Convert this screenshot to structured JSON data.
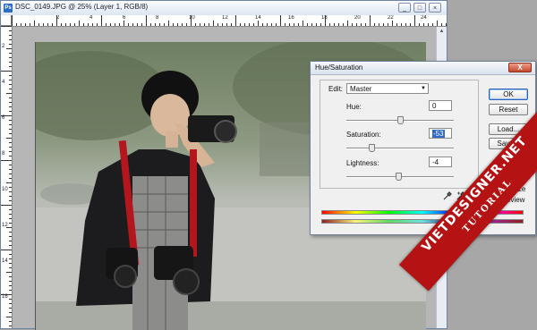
{
  "document": {
    "title": "DSC_0149.JPG @ 25% (Layer 1, RGB/8)",
    "app_icon": "Ps",
    "window_buttons": [
      "_",
      "□",
      "×"
    ],
    "ruler_top_labels": [
      "2",
      "4",
      "6",
      "8",
      "10",
      "12",
      "14",
      "16",
      "18",
      "20",
      "22",
      "24"
    ],
    "ruler_left_labels": [
      "2",
      "4",
      "6",
      "8",
      "10",
      "12",
      "14",
      "16"
    ]
  },
  "dialog": {
    "title": "Hue/Saturation",
    "close_label": "X",
    "edit_label": "Edit:",
    "edit_value": "Master",
    "hue": {
      "label": "Hue:",
      "value": "0",
      "level": 0.5
    },
    "saturation": {
      "label": "Saturation:",
      "value": "-53",
      "level": 0.235
    },
    "lightness": {
      "label": "Lightness:",
      "value": "-4",
      "level": 0.48
    },
    "buttons": {
      "ok": "OK",
      "reset": "Reset",
      "load": "Load...",
      "save": "Save..."
    },
    "colorize": {
      "label": "Colorize",
      "checked": false
    },
    "preview": {
      "label": "Preview",
      "checked": true
    }
  },
  "watermark": {
    "brand": "VIETDESIGNER.NET",
    "tagline": "TUTORIAL"
  }
}
